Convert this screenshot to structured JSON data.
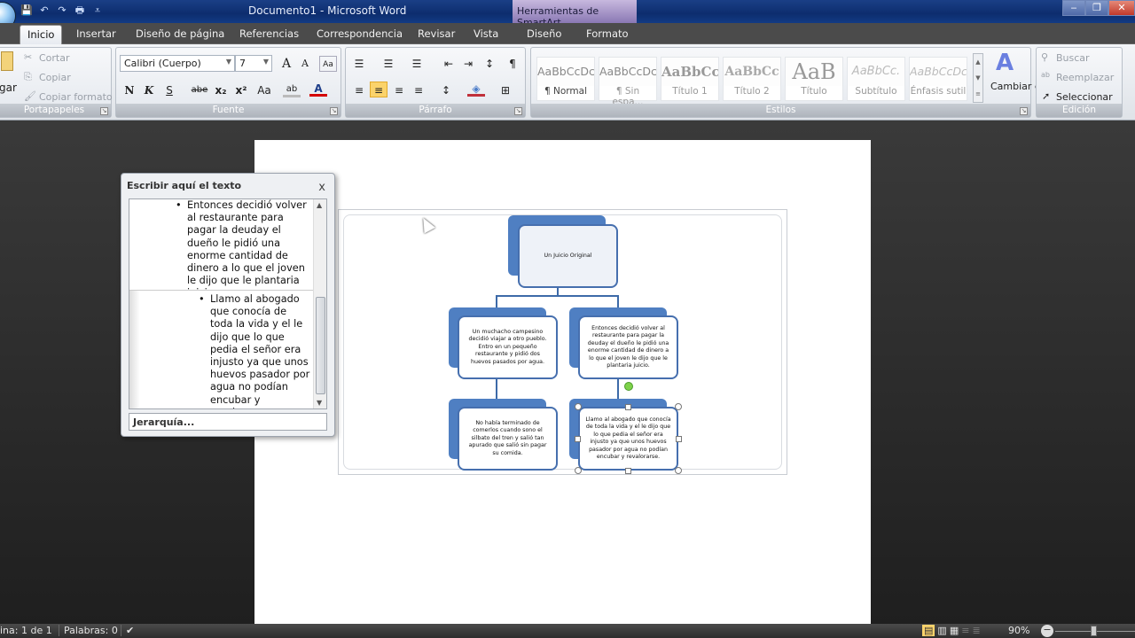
{
  "window": {
    "title": "Documento1 - Microsoft Word",
    "context_tab_group": "Herramientas de SmartArt",
    "controls": {
      "minimize": "‒",
      "restore": "❐",
      "close": "✕"
    }
  },
  "quick_access": {
    "save": "💾",
    "undo": "↶",
    "redo": "↷",
    "print": "🖶",
    "customize": "⩡"
  },
  "tabs": [
    {
      "label": "Inicio",
      "active": true
    },
    {
      "label": "Insertar"
    },
    {
      "label": "Diseño de página"
    },
    {
      "label": "Referencias"
    },
    {
      "label": "Correspondencia"
    },
    {
      "label": "Revisar"
    },
    {
      "label": "Vista"
    },
    {
      "label": "Diseño"
    },
    {
      "label": "Formato"
    }
  ],
  "ribbon": {
    "portapapeles": {
      "label": "Portapapeles",
      "paste": "gar",
      "cut": "Cortar",
      "copy": "Copiar",
      "format_painter": "Copiar formato"
    },
    "fuente": {
      "label": "Fuente",
      "font_name": "Calibri (Cuerpo)",
      "font_size": "7",
      "grow": "A",
      "shrink": "A",
      "clear": "Aa",
      "bold": "N",
      "italic": "K",
      "underline": "S",
      "strike": "abe",
      "subscript": "x₂",
      "superscript": "x²",
      "change_case": "Aa",
      "highlight": "ab",
      "font_color": "A"
    },
    "parrafo": {
      "label": "Párrafo",
      "bullets": "☰",
      "numbering": "☰",
      "multilevel": "☰",
      "decrease_indent": "⇤",
      "increase_indent": "⇥",
      "sort": "↕",
      "show_marks": "¶",
      "align_left": "≡",
      "center": "≡",
      "align_right": "≡",
      "justify": "≡",
      "line_spacing": "↕",
      "shading": "◈",
      "borders": "⊞"
    },
    "estilos": {
      "label": "Estilos",
      "items": [
        {
          "preview": "AaBbCcDc",
          "name": "¶ Normal"
        },
        {
          "preview": "AaBbCcDc",
          "name": "¶ Sin espa..."
        },
        {
          "preview": "AaBbCc",
          "name": "Título 1"
        },
        {
          "preview": "AaBbCc",
          "name": "Título 2"
        },
        {
          "preview": "AaB",
          "name": "Título"
        },
        {
          "preview": "AaBbCc.",
          "name": "Subtítulo"
        },
        {
          "preview": "AaBbCcDc",
          "name": "Énfasis sutil"
        }
      ],
      "change_styles": "Cambiar estilos"
    },
    "edicion": {
      "label": "Edición",
      "find": "Buscar",
      "replace": "Reemplazar",
      "select": "Seleccionar"
    }
  },
  "text_pane": {
    "title": "Escribir aquí el texto",
    "close": "x",
    "items": [
      "Entonces decidió volver al restaurante para pagar la deuday el dueño le pidió una enorme cantidad de dinero a lo que el joven le dijo que le plantaria juicio.",
      "Llamo al abogado que conocía de toda la vida y el le dijo que lo que pedia el señor era injusto ya que unos huevos pasador por agua no podían encubar y revalorarse."
    ],
    "footer": "Jerarquía...",
    "scroll_up": "▲",
    "scroll_down": "▼"
  },
  "smartart": {
    "root": "Un Juicio Original",
    "nodes": [
      "Un muchacho campesino decidió viajar a otro pueblo. Entro en un pequeño restaurante y pidió dos huevos pasados por agua.",
      "Entonces decidió volver al restaurante para pagar la deuday el dueño le pidió una enorme cantidad de dinero a lo que el joven le dijo que le plantaria juicio.",
      "No había terminado de comerlos cuando sono el silbato del tren y salió tan apurado que salió sin pagar su comida.",
      "Llamo al abogado que conocía de toda la vida y el le dijo que lo que pedia el señor era injusto ya que unos huevos pasador por agua no podían encubar y revalorarse."
    ]
  },
  "statusbar": {
    "page": "ina: 1 de 1",
    "words": "Palabras: 0",
    "zoom": "90%"
  }
}
